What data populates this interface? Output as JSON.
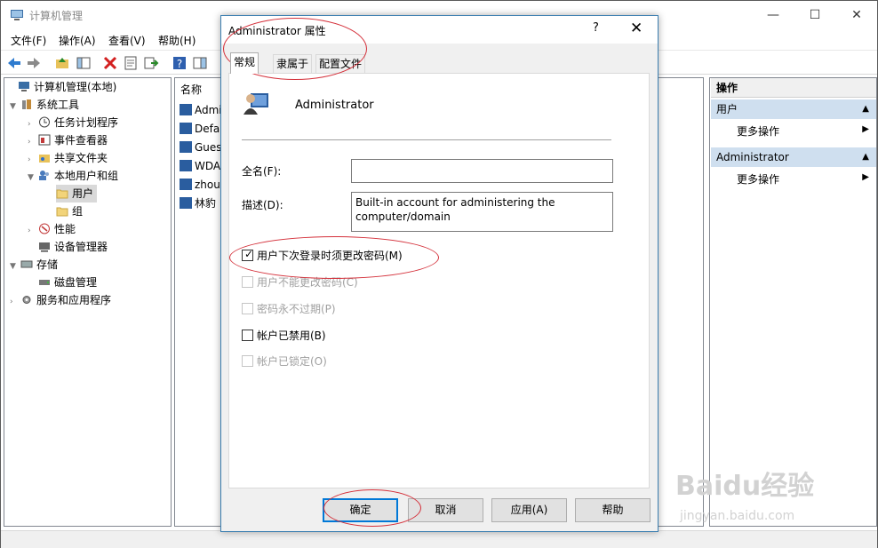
{
  "window": {
    "title": "计算机管理",
    "min": "—",
    "max": "☐",
    "close": "✕"
  },
  "menu": [
    "文件(F)",
    "操作(A)",
    "查看(V)",
    "帮助(H)"
  ],
  "tree": [
    {
      "label": "计算机管理(本地)"
    },
    {
      "label": "系统工具"
    },
    {
      "label": "任务计划程序"
    },
    {
      "label": "事件查看器"
    },
    {
      "label": "共享文件夹"
    },
    {
      "label": "本地用户和组"
    },
    {
      "label": "用户"
    },
    {
      "label": "组"
    },
    {
      "label": "性能"
    },
    {
      "label": "设备管理器"
    },
    {
      "label": "存储"
    },
    {
      "label": "磁盘管理"
    },
    {
      "label": "服务和应用程序"
    }
  ],
  "list": {
    "header": "名称",
    "rows": [
      "Admin",
      "Defa",
      "Gues",
      "WDA",
      "zhou",
      "林豹"
    ]
  },
  "actions": {
    "title": "操作",
    "group1": "用户",
    "group1_more": "更多操作",
    "group2": "Administrator",
    "group2_more": "更多操作"
  },
  "dialog": {
    "title": "Administrator 属性",
    "help": "?",
    "close": "✕",
    "tabs": [
      "常规",
      "隶属于",
      "配置文件"
    ],
    "username": "Administrator",
    "fullname_label": "全名(F):",
    "fullname_value": "",
    "desc_label": "描述(D):",
    "desc_value": "Built-in account for administering the computer/domain",
    "checkboxes": [
      {
        "label": "用户下次登录时须更改密码(M)",
        "checked": true,
        "enabled": true
      },
      {
        "label": "用户不能更改密码(C)",
        "checked": false,
        "enabled": false
      },
      {
        "label": "密码永不过期(P)",
        "checked": false,
        "enabled": false
      },
      {
        "label": "帐户已禁用(B)",
        "checked": false,
        "enabled": true
      },
      {
        "label": "帐户已锁定(O)",
        "checked": false,
        "enabled": false
      }
    ],
    "buttons": {
      "ok": "确定",
      "cancel": "取消",
      "apply": "应用(A)",
      "help": "帮助"
    }
  },
  "watermark": {
    "line1": "Baidu经验",
    "line2": "jingyan.baidu.com"
  },
  "colors": {
    "accent": "#0078d7",
    "annotation": "#d4303a",
    "actions_header": "#cfdfef"
  }
}
